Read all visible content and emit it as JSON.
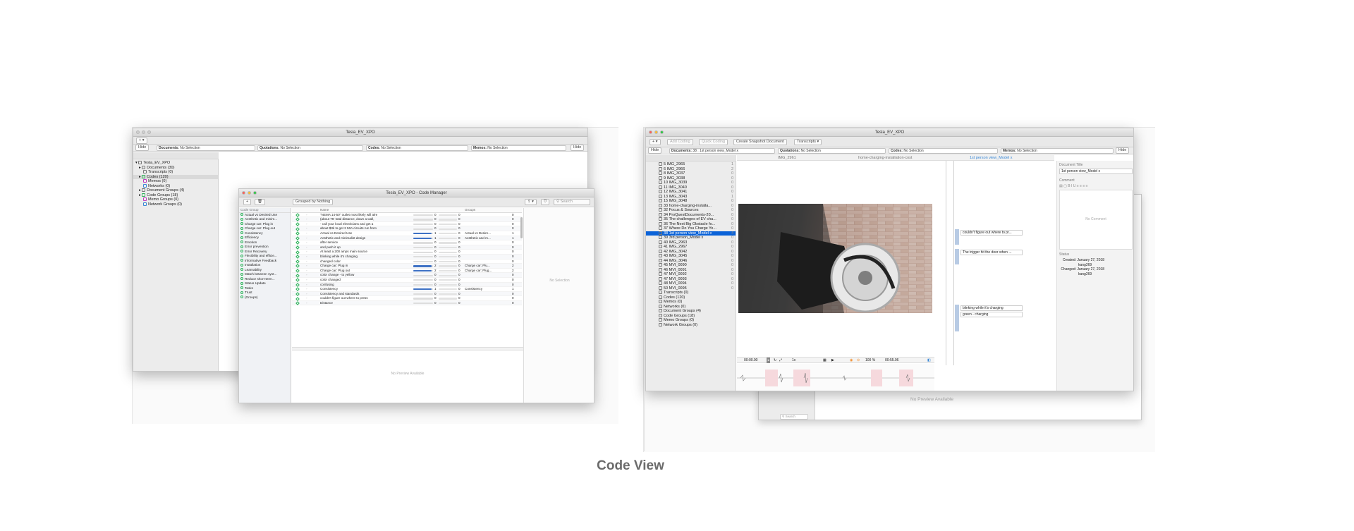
{
  "caption": "Code View",
  "left": {
    "title": "Tesla_EV_XPO",
    "hide_left": "Hide",
    "hide_right": "Hide",
    "selectors": [
      {
        "label": "Documents:",
        "value": "No Selection"
      },
      {
        "label": "Quotations:",
        "value": "No Selection"
      },
      {
        "label": "Codes:",
        "value": "No Selection"
      },
      {
        "label": "Memos:",
        "value": "No Selection"
      }
    ],
    "tree": [
      {
        "label": "Tesla_EV_XPO"
      },
      {
        "label": "Documents (30)"
      },
      {
        "label": "Transcripts (0)"
      },
      {
        "label": "Codes (120)"
      },
      {
        "label": "Memos (0)"
      },
      {
        "label": "Networks (0)"
      },
      {
        "label": "Document Groups (4)"
      },
      {
        "label": "Code Groups (18)"
      },
      {
        "label": "Memo Groups (0)"
      },
      {
        "label": "Network Groups (0)"
      }
    ]
  },
  "code_manager": {
    "title": "Tesla_EV_XPO - Code Manager",
    "grouped_by": "Grouped by Nothing",
    "search_placeholder": "Search",
    "group_header": "Code Group",
    "col_name": "Name",
    "col_groups": "Groups",
    "groups": [
      "Actual vs Desired Use",
      "Aesthetic and minim...",
      "Charge car: Plug in",
      "Charge car: Plug out",
      "Consistency",
      "Efficiency",
      "Emotion",
      "Error prevention",
      "Error Recovery",
      "Flexibility and efficie...",
      "Informative Feedback",
      "Installation",
      "Learnability",
      "Match between syst...",
      "Reduce short-term...",
      "Status Update",
      "Tasks",
      "Trust",
      "(Groups)"
    ],
    "codes": [
      {
        "name": "\"NEMA 14-50\" outlet most likely will alre",
        "count": "0",
        "g": ""
      },
      {
        "name": "(about 75' total distance, down a wall,",
        "count": "0",
        "g": ""
      },
      {
        "name": "- call your local electricians and get a",
        "count": "0",
        "g": ""
      },
      {
        "name": "about $3k to get 2 50A circuits run from",
        "count": "0",
        "g": ""
      },
      {
        "name": "Actual vs Desired Use",
        "count": "1",
        "g": "Actual vs Desire..."
      },
      {
        "name": "Aesthetic and minimalist design",
        "count": "1",
        "g": "Aesthetic and m..."
      },
      {
        "name": "after service",
        "count": "0",
        "g": ""
      },
      {
        "name": "and push it up",
        "count": "0",
        "g": ""
      },
      {
        "name": "At least a 200 amps main source",
        "count": "0",
        "g": ""
      },
      {
        "name": "blinking while it's charging",
        "count": "0",
        "g": ""
      },
      {
        "name": "changed color",
        "count": "0",
        "g": ""
      },
      {
        "name": "Charge car: Plug in",
        "count": "2",
        "g": "Charge car: Plu..."
      },
      {
        "name": "Charge car: Plug out",
        "count": "2",
        "g": "Charge car: Plug..."
      },
      {
        "name": "color change - to yellow",
        "count": "0",
        "g": ""
      },
      {
        "name": "color changed",
        "count": "0",
        "g": ""
      },
      {
        "name": "confusing",
        "count": "0",
        "g": ""
      },
      {
        "name": "Consistency",
        "count": "1",
        "g": "Consistency"
      },
      {
        "name": "Consistency and standards",
        "count": "0",
        "g": ""
      },
      {
        "name": "couldn't figure out where to press",
        "count": "0",
        "g": ""
      },
      {
        "name": "Distance",
        "count": "0",
        "g": ""
      }
    ],
    "no_selection": "No Selection",
    "no_preview": "No Preview Available"
  },
  "right": {
    "title": "Tesla_EV_XPO",
    "add_coding": "Add Coding",
    "quick_coding": "Quick Coding",
    "create_snapshot": "Create Snapshot Document",
    "transcripts": "Transcripts",
    "hide_left": "Hide",
    "hide_right": "Hide",
    "selectors": [
      {
        "label": "Documents:",
        "value": "38 : 1st person view_Model x"
      },
      {
        "label": "Quotations:",
        "value": "No Selection"
      },
      {
        "label": "Codes:",
        "value": "No Selection"
      },
      {
        "label": "Memos:",
        "value": "No Selection"
      }
    ],
    "tabs": [
      "IMG_2961",
      "home-charging-installation-cost",
      "1st person view_Model x"
    ],
    "docs": [
      {
        "n": "5 IMG_2965",
        "c": "1"
      },
      {
        "n": "6 IMG_2966",
        "c": "2"
      },
      {
        "n": "8 IMG_3037",
        "c": "0"
      },
      {
        "n": "9 IMG_3038",
        "c": "0"
      },
      {
        "n": "10 IMG_3039",
        "c": "0"
      },
      {
        "n": "11 IMG_3040",
        "c": "0"
      },
      {
        "n": "12 IMG_3041",
        "c": "0"
      },
      {
        "n": "13 IMG_3043",
        "c": "1"
      },
      {
        "n": "15 IMG_3048",
        "c": "0"
      },
      {
        "n": "33 home-charging-installa...",
        "c": "0"
      },
      {
        "n": "32 Focus & Sources",
        "c": "0"
      },
      {
        "n": "34 ProQuestDocuments-20...",
        "c": "0"
      },
      {
        "n": "35 The challenges of EV cha...",
        "c": "0"
      },
      {
        "n": "36 The Next Big Obstacle fo...",
        "c": "0"
      },
      {
        "n": "37 Where Do You Charge Yo...",
        "c": "0"
      },
      {
        "n": "38 1st person view_Model x",
        "c": "4"
      },
      {
        "n": "39 3rd person_Model x",
        "c": "0"
      },
      {
        "n": "40 IMG_2963",
        "c": "0"
      },
      {
        "n": "41 IMG_2967",
        "c": "0"
      },
      {
        "n": "42 IMG_3042",
        "c": "0"
      },
      {
        "n": "43 IMG_3045",
        "c": "0"
      },
      {
        "n": "44 IMG_3046",
        "c": "0"
      },
      {
        "n": "45 MVI_0090",
        "c": "0"
      },
      {
        "n": "46 MVI_0091",
        "c": "0"
      },
      {
        "n": "47 MVI_0092",
        "c": "0"
      },
      {
        "n": "47 MVI_0093",
        "c": "0"
      },
      {
        "n": "48 MVI_0094",
        "c": "0"
      },
      {
        "n": "50 MVI_0095",
        "c": "0"
      }
    ],
    "tree_bottom": [
      "Transcripts (0)",
      "Codes (120)",
      "Memos (0)",
      "Networks (0)",
      "Document Groups (4)",
      "Code Groups (18)",
      "Memo Groups (0)",
      "Network Groups (0)"
    ],
    "quotes": [
      "couldn't figure out where to pr...",
      "The trigger hit the door when ...",
      "blinking while it's charging",
      "green - charging"
    ],
    "time_start": "00:00.00",
    "time_end": "00:55.06",
    "zoom": "100 %",
    "speed": "1x",
    "doc_title_label": "Document Title",
    "doc_title_value": "1st person view_Model x",
    "comment_label": "Comment",
    "no_comment": "No Comment",
    "status_label": "Status",
    "created_label": "Created:",
    "created_value": "January 27, 2018",
    "created_by": "kang269",
    "changed_label": "Changed:",
    "changed_value": "January 27, 2018",
    "changed_by": "kang269",
    "behind_preview": "No Preview Available",
    "search_placeholder": "Search"
  },
  "colors": {
    "accent": "#0a62d8",
    "bar": "#3f72c5",
    "green": "#2db35a"
  }
}
